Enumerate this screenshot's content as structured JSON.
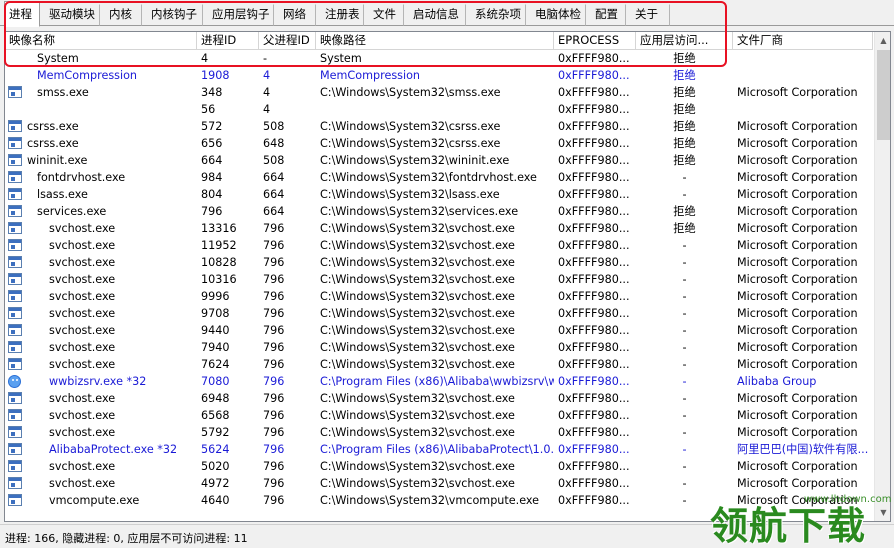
{
  "tabs": [
    "进程",
    "驱动模块",
    "内核",
    "内核钩子",
    "应用层钩子",
    "网络",
    "注册表",
    "文件",
    "启动信息",
    "系统杂项",
    "电脑体检",
    "配置",
    "关于"
  ],
  "active_tab": 0,
  "columns": [
    "映像名称",
    "进程ID",
    "父进程ID",
    "映像路径",
    "EPROCESS",
    "应用层访问...",
    "文件厂商"
  ],
  "rows": [
    {
      "name": "System",
      "pid": "4",
      "ppid": "-",
      "path": "System",
      "eproc": "0xFFFF980...",
      "access": "拒绝",
      "vendor": "",
      "icon": "none",
      "indent": 1,
      "blue": false
    },
    {
      "name": "MemCompression",
      "pid": "1908",
      "ppid": "4",
      "path": "MemCompression",
      "eproc": "0xFFFF980...",
      "access": "拒绝",
      "vendor": "",
      "icon": "none",
      "indent": 2,
      "blue": true
    },
    {
      "name": "smss.exe",
      "pid": "348",
      "ppid": "4",
      "path": "C:\\Windows\\System32\\smss.exe",
      "eproc": "0xFFFF980...",
      "access": "拒绝",
      "vendor": "Microsoft Corporation",
      "icon": "app",
      "indent": 2,
      "blue": false
    },
    {
      "name": "",
      "pid": "56",
      "ppid": "4",
      "path": "",
      "eproc": "0xFFFF980...",
      "access": "拒绝",
      "vendor": "",
      "icon": "none",
      "indent": 2,
      "blue": false
    },
    {
      "name": "csrss.exe",
      "pid": "572",
      "ppid": "508",
      "path": "C:\\Windows\\System32\\csrss.exe",
      "eproc": "0xFFFF980...",
      "access": "拒绝",
      "vendor": "Microsoft Corporation",
      "icon": "app",
      "indent": 0,
      "blue": false
    },
    {
      "name": "csrss.exe",
      "pid": "656",
      "ppid": "648",
      "path": "C:\\Windows\\System32\\csrss.exe",
      "eproc": "0xFFFF980...",
      "access": "拒绝",
      "vendor": "Microsoft Corporation",
      "icon": "app",
      "indent": 0,
      "blue": false
    },
    {
      "name": "wininit.exe",
      "pid": "664",
      "ppid": "508",
      "path": "C:\\Windows\\System32\\wininit.exe",
      "eproc": "0xFFFF980...",
      "access": "拒绝",
      "vendor": "Microsoft Corporation",
      "icon": "app",
      "indent": 0,
      "blue": false
    },
    {
      "name": "fontdrvhost.exe",
      "pid": "984",
      "ppid": "664",
      "path": "C:\\Windows\\System32\\fontdrvhost.exe",
      "eproc": "0xFFFF980...",
      "access": "-",
      "vendor": "Microsoft Corporation",
      "icon": "app",
      "indent": 2,
      "blue": false
    },
    {
      "name": "lsass.exe",
      "pid": "804",
      "ppid": "664",
      "path": "C:\\Windows\\System32\\lsass.exe",
      "eproc": "0xFFFF980...",
      "access": "-",
      "vendor": "Microsoft Corporation",
      "icon": "app",
      "indent": 2,
      "blue": false
    },
    {
      "name": "services.exe",
      "pid": "796",
      "ppid": "664",
      "path": "C:\\Windows\\System32\\services.exe",
      "eproc": "0xFFFF980...",
      "access": "拒绝",
      "vendor": "Microsoft Corporation",
      "icon": "app",
      "indent": 2,
      "blue": false
    },
    {
      "name": "svchost.exe",
      "pid": "13316",
      "ppid": "796",
      "path": "C:\\Windows\\System32\\svchost.exe",
      "eproc": "0xFFFF980...",
      "access": "拒绝",
      "vendor": "Microsoft Corporation",
      "icon": "app",
      "indent": 3,
      "blue": false
    },
    {
      "name": "svchost.exe",
      "pid": "11952",
      "ppid": "796",
      "path": "C:\\Windows\\System32\\svchost.exe",
      "eproc": "0xFFFF980...",
      "access": "-",
      "vendor": "Microsoft Corporation",
      "icon": "app",
      "indent": 3,
      "blue": false
    },
    {
      "name": "svchost.exe",
      "pid": "10828",
      "ppid": "796",
      "path": "C:\\Windows\\System32\\svchost.exe",
      "eproc": "0xFFFF980...",
      "access": "-",
      "vendor": "Microsoft Corporation",
      "icon": "app",
      "indent": 3,
      "blue": false
    },
    {
      "name": "svchost.exe",
      "pid": "10316",
      "ppid": "796",
      "path": "C:\\Windows\\System32\\svchost.exe",
      "eproc": "0xFFFF980...",
      "access": "-",
      "vendor": "Microsoft Corporation",
      "icon": "app",
      "indent": 3,
      "blue": false
    },
    {
      "name": "svchost.exe",
      "pid": "9996",
      "ppid": "796",
      "path": "C:\\Windows\\System32\\svchost.exe",
      "eproc": "0xFFFF980...",
      "access": "-",
      "vendor": "Microsoft Corporation",
      "icon": "app",
      "indent": 3,
      "blue": false
    },
    {
      "name": "svchost.exe",
      "pid": "9708",
      "ppid": "796",
      "path": "C:\\Windows\\System32\\svchost.exe",
      "eproc": "0xFFFF980...",
      "access": "-",
      "vendor": "Microsoft Corporation",
      "icon": "app",
      "indent": 3,
      "blue": false
    },
    {
      "name": "svchost.exe",
      "pid": "9440",
      "ppid": "796",
      "path": "C:\\Windows\\System32\\svchost.exe",
      "eproc": "0xFFFF980...",
      "access": "-",
      "vendor": "Microsoft Corporation",
      "icon": "app",
      "indent": 3,
      "blue": false
    },
    {
      "name": "svchost.exe",
      "pid": "7940",
      "ppid": "796",
      "path": "C:\\Windows\\System32\\svchost.exe",
      "eproc": "0xFFFF980...",
      "access": "-",
      "vendor": "Microsoft Corporation",
      "icon": "app",
      "indent": 3,
      "blue": false
    },
    {
      "name": "svchost.exe",
      "pid": "7624",
      "ppid": "796",
      "path": "C:\\Windows\\System32\\svchost.exe",
      "eproc": "0xFFFF980...",
      "access": "-",
      "vendor": "Microsoft Corporation",
      "icon": "app",
      "indent": 3,
      "blue": false
    },
    {
      "name": "wwbizsrv.exe *32",
      "pid": "7080",
      "ppid": "796",
      "path": "C:\\Program Files (x86)\\Alibaba\\wwbizsrv\\ww...",
      "eproc": "0xFFFF980...",
      "access": "-",
      "vendor": "Alibaba Group",
      "icon": "globe",
      "indent": 3,
      "blue": true
    },
    {
      "name": "svchost.exe",
      "pid": "6948",
      "ppid": "796",
      "path": "C:\\Windows\\System32\\svchost.exe",
      "eproc": "0xFFFF980...",
      "access": "-",
      "vendor": "Microsoft Corporation",
      "icon": "app",
      "indent": 3,
      "blue": false
    },
    {
      "name": "svchost.exe",
      "pid": "6568",
      "ppid": "796",
      "path": "C:\\Windows\\System32\\svchost.exe",
      "eproc": "0xFFFF980...",
      "access": "-",
      "vendor": "Microsoft Corporation",
      "icon": "app",
      "indent": 3,
      "blue": false
    },
    {
      "name": "svchost.exe",
      "pid": "5792",
      "ppid": "796",
      "path": "C:\\Windows\\System32\\svchost.exe",
      "eproc": "0xFFFF980...",
      "access": "-",
      "vendor": "Microsoft Corporation",
      "icon": "app",
      "indent": 3,
      "blue": false
    },
    {
      "name": "AlibabaProtect.exe *32",
      "pid": "5624",
      "ppid": "796",
      "path": "C:\\Program Files (x86)\\AlibabaProtect\\1.0.2...",
      "eproc": "0xFFFF980...",
      "access": "-",
      "vendor": "阿里巴巴(中国)软件有限...",
      "icon": "app",
      "indent": 3,
      "blue": true
    },
    {
      "name": "svchost.exe",
      "pid": "5020",
      "ppid": "796",
      "path": "C:\\Windows\\System32\\svchost.exe",
      "eproc": "0xFFFF980...",
      "access": "-",
      "vendor": "Microsoft Corporation",
      "icon": "app",
      "indent": 3,
      "blue": false
    },
    {
      "name": "svchost.exe",
      "pid": "4972",
      "ppid": "796",
      "path": "C:\\Windows\\System32\\svchost.exe",
      "eproc": "0xFFFF980...",
      "access": "-",
      "vendor": "Microsoft Corporation",
      "icon": "app",
      "indent": 3,
      "blue": false
    },
    {
      "name": "vmcompute.exe",
      "pid": "4640",
      "ppid": "796",
      "path": "C:\\Windows\\System32\\vmcompute.exe",
      "eproc": "0xFFFF980...",
      "access": "-",
      "vendor": "Microsoft Corporation",
      "icon": "app",
      "indent": 3,
      "blue": false
    }
  ],
  "status": {
    "text": "进程:  166, 隐藏进程:  0, 应用层不可访问进程:  11"
  },
  "watermark": {
    "url": "www.lhdown.com",
    "text": "领航下载"
  },
  "colors": {
    "highlight": "#e81123",
    "blue_row": "#1a1ad6"
  }
}
